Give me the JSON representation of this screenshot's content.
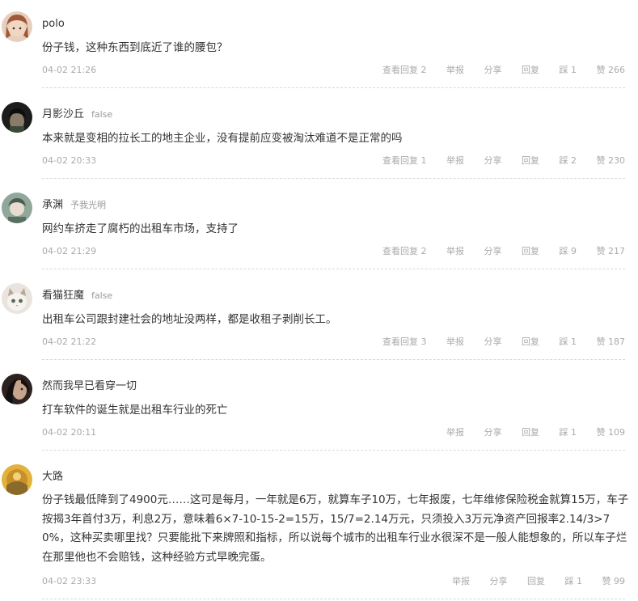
{
  "comments": [
    {
      "username": "polo",
      "tag": "",
      "content": "份子钱，这种东西到底近了谁的腰包？",
      "time": "04-02 21:26",
      "view_replies": "查看回复 2",
      "report": "举报",
      "share": "分享",
      "reply": "回复",
      "dislike": "踩 1",
      "like": "赞 266"
    },
    {
      "username": "月影沙丘",
      "tag": "false",
      "content": "本来就是变相的拉长工的地主企业，没有提前应变被淘汰难道不是正常的吗",
      "time": "04-02 20:33",
      "view_replies": "查看回复 1",
      "report": "举报",
      "share": "分享",
      "reply": "回复",
      "dislike": "踩 2",
      "like": "赞 230"
    },
    {
      "username": "承渊",
      "tag": "予我光明",
      "content": "网约车挤走了腐朽的出租车市场，支持了",
      "time": "04-02 21:29",
      "view_replies": "查看回复 2",
      "report": "举报",
      "share": "分享",
      "reply": "回复",
      "dislike": "踩 9",
      "like": "赞 217"
    },
    {
      "username": "看猫狂魔",
      "tag": "false",
      "content": "出租车公司跟封建社会的地址没两样，都是收租子剥削长工。",
      "time": "04-02 21:22",
      "view_replies": "查看回复 3",
      "report": "举报",
      "share": "分享",
      "reply": "回复",
      "dislike": "踩 1",
      "like": "赞 187"
    },
    {
      "username": "然而我早已看穿一切",
      "tag": "",
      "content": "打车软件的诞生就是出租车行业的死亡",
      "time": "04-02 20:11",
      "view_replies": "",
      "report": "举报",
      "share": "分享",
      "reply": "回复",
      "dislike": "踩 1",
      "like": "赞 109"
    },
    {
      "username": "大路",
      "tag": "",
      "content": "份子钱最低降到了4900元……这可是每月，一年就是6万，就算车子10万，七年报废，七年维修保险税金就算15万，车子按揭3年首付3万，利息2万，意味着6×7-10-15-2=15万，15/7=2.14万元，只须投入3万元净资产回报率2.14/3>70%，这种买卖哪里找？只要能批下来牌照和指标，所以说每个城市的出租车行业水很深不是一般人能想象的，所以车子烂在那里他也不会赔钱，这种经验方式早晚完蛋。",
      "time": "04-02 23:33",
      "view_replies": "",
      "report": "举报",
      "share": "分享",
      "reply": "回复",
      "dislike": "踩 1",
      "like": "赞 99"
    }
  ],
  "avatar_colors": [
    "#c98a62",
    "#2a2a2a",
    "#6f8f7a",
    "#d8d2cb",
    "#3a2a28",
    "#c89a2c"
  ]
}
